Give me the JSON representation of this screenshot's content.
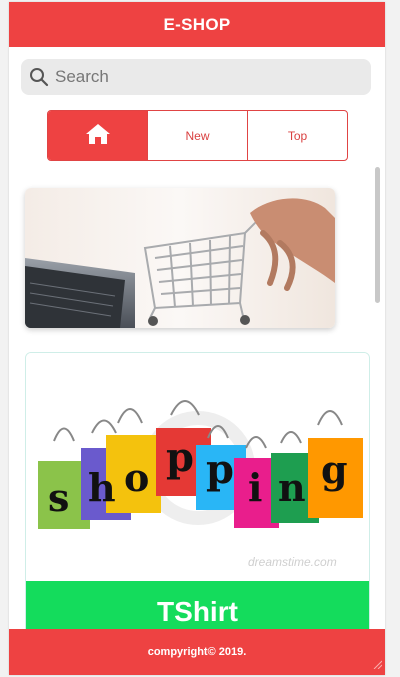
{
  "app": {
    "title": "E-SHOP"
  },
  "search": {
    "placeholder": "Search"
  },
  "tabs": [
    {
      "icon": "home-icon",
      "label": ""
    },
    {
      "label": "New"
    },
    {
      "label": "Top"
    }
  ],
  "cards": [
    {
      "image": "shopping-cart-laptop-photo"
    },
    {
      "image": "shopping-bags-illustration",
      "label": "TShirt",
      "watermark": "dreamstime.com",
      "letters": [
        "s",
        "h",
        "o",
        "p",
        "p",
        "i",
        "n",
        "g"
      ]
    }
  ],
  "footer": {
    "text": "compyright© 2019."
  },
  "colors": {
    "primary": "#ee4242",
    "card_label_bg": "#14dc5c"
  }
}
